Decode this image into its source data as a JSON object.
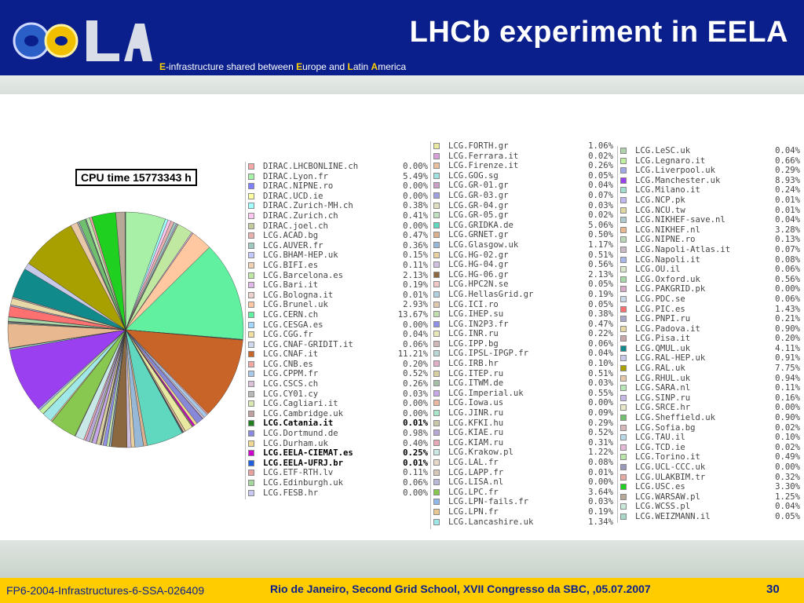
{
  "header": {
    "title": "LHCb experiment in EELA",
    "subtitle": {
      "e1": "E",
      "t1": "-infrastructure shared between ",
      "e2": "E",
      "t2": "urope and ",
      "e3": "L",
      "t3": "atin ",
      "e4": "A",
      "t4": "merica"
    },
    "logo_text": "eeLA"
  },
  "chart": {
    "label": "CPU time 15773343 h"
  },
  "chart_data": {
    "type": "pie",
    "title": "CPU time 15773343 h",
    "slices": [
      {
        "name": "DIRAC.LHCBONLINE.ch",
        "value": 0.0,
        "color": "#f7a8a8"
      },
      {
        "name": "DIRAC.Lyon.fr",
        "value": 5.49,
        "color": "#a8f0a8"
      },
      {
        "name": "DIRAC.NIPNE.ro",
        "value": 0.0,
        "color": "#8080ff"
      },
      {
        "name": "DIRAC.UCD.ie",
        "value": 0.0,
        "color": "#ffffa0"
      },
      {
        "name": "DIRAC.Zurich-MH.ch",
        "value": 0.38,
        "color": "#a0ffff"
      },
      {
        "name": "DIRAC.Zurich.ch",
        "value": 0.41,
        "color": "#ffc8f0"
      },
      {
        "name": "DIRAC.joel.ch",
        "value": 0.0,
        "color": "#c8c8a0"
      },
      {
        "name": "LCG.ACAD.bg",
        "value": 0.47,
        "color": "#e8b0b0"
      },
      {
        "name": "LCG.AUVER.fr",
        "value": 0.36,
        "color": "#a0c8c0"
      },
      {
        "name": "LCG.BHAM-HEP.uk",
        "value": 0.15,
        "color": "#c0c8ff"
      },
      {
        "name": "LCG.BIFI.es",
        "value": 0.11,
        "color": "#f0d0b0"
      },
      {
        "name": "LCG.Barcelona.es",
        "value": 2.13,
        "color": "#c0e8a0"
      },
      {
        "name": "LCG.Bari.it",
        "value": 0.19,
        "color": "#e0b8e8"
      },
      {
        "name": "LCG.Bologna.it",
        "value": 0.01,
        "color": "#e8d0d0"
      },
      {
        "name": "LCG.Brunel.uk",
        "value": 2.93,
        "color": "#ffc8a0"
      },
      {
        "name": "LCG.CERN.ch",
        "value": 13.67,
        "color": "#60f0a0"
      },
      {
        "name": "LCG.CESGA.es",
        "value": 0.0,
        "color": "#a0d8ff"
      },
      {
        "name": "LCG.CGG.fr",
        "value": 0.04,
        "color": "#f0e0a0"
      },
      {
        "name": "LCG.CNAF-GRIDIT.it",
        "value": 0.06,
        "color": "#d0d8f0"
      },
      {
        "name": "LCG.CNAF.it",
        "value": 11.21,
        "color": "#c86428"
      },
      {
        "name": "LCG.CNB.es",
        "value": 0.2,
        "color": "#f0a8a0"
      },
      {
        "name": "LCG.CPPM.fr",
        "value": 0.52,
        "color": "#a8c8e8"
      },
      {
        "name": "LCG.CSCS.ch",
        "value": 0.26,
        "color": "#d8c0d8"
      },
      {
        "name": "LCG.CY01.cy",
        "value": 0.03,
        "color": "#b8b8b8"
      },
      {
        "name": "LCG.Cagliari.it",
        "value": 0.0,
        "color": "#d8e8b0"
      },
      {
        "name": "LCG.Cambridge.uk",
        "value": 0.0,
        "color": "#c0a0a0"
      },
      {
        "name": "LCG.Catania.it",
        "value": 0.01,
        "color": "#208020",
        "bold": true
      },
      {
        "name": "LCG.Dortmund.de",
        "value": 0.98,
        "color": "#8888d8"
      },
      {
        "name": "LCG.Durham.uk",
        "value": 0.4,
        "color": "#f0d890"
      },
      {
        "name": "LCG.EELA-CIEMAT.es",
        "value": 0.25,
        "color": "#d000d0",
        "bold": true
      },
      {
        "name": "LCG.EELA-UFRJ.br",
        "value": 0.01,
        "color": "#2060e0",
        "bold": true
      },
      {
        "name": "LCG.ETF-RTH.lv",
        "value": 0.11,
        "color": "#e8a0a0"
      },
      {
        "name": "LCG.Edinburgh.uk",
        "value": 0.06,
        "color": "#a0d8a0"
      },
      {
        "name": "LCG.FESB.hr",
        "value": 0.0,
        "color": "#c8c8f0"
      },
      {
        "name": "LCG.FORTH.gr",
        "value": 1.06,
        "color": "#e8e8a0"
      },
      {
        "name": "LCG.Ferrara.it",
        "value": 0.02,
        "color": "#d8a0d8"
      },
      {
        "name": "LCG.Firenze.it",
        "value": 0.26,
        "color": "#e8c0a0"
      },
      {
        "name": "LCG.GOG.sg",
        "value": 0.05,
        "color": "#a0e0e0"
      },
      {
        "name": "LCG.GR-01.gr",
        "value": 0.04,
        "color": "#c8a0c8"
      },
      {
        "name": "LCG.GR-03.gr",
        "value": 0.07,
        "color": "#a0a0e0"
      },
      {
        "name": "LCG.GR-04.gr",
        "value": 0.03,
        "color": "#e0e0c0"
      },
      {
        "name": "LCG.GR-05.gr",
        "value": 0.02,
        "color": "#c0e0c0"
      },
      {
        "name": "LCG.GRIDKA.de",
        "value": 5.06,
        "color": "#60d8c0"
      },
      {
        "name": "LCG.GRNET.gr",
        "value": 0.5,
        "color": "#d8b090"
      },
      {
        "name": "LCG.Glasgow.uk",
        "value": 1.17,
        "color": "#98b8d8"
      },
      {
        "name": "LCG.HG-02.gr",
        "value": 0.51,
        "color": "#e8d0a0"
      },
      {
        "name": "LCG.HG-04.gr",
        "value": 0.56,
        "color": "#d0c0e0"
      },
      {
        "name": "LCG.HG-06.gr",
        "value": 2.13,
        "color": "#8c6840"
      },
      {
        "name": "LCG.HPC2N.se",
        "value": 0.05,
        "color": "#f0c8c8"
      },
      {
        "name": "LCG.HellasGrid.gr",
        "value": 0.19,
        "color": "#b0d0e0"
      },
      {
        "name": "LCG.ICI.ro",
        "value": 0.05,
        "color": "#e0c8b0"
      },
      {
        "name": "LCG.IHEP.su",
        "value": 0.38,
        "color": "#c0e0b0"
      },
      {
        "name": "LCG.IN2P3.fr",
        "value": 0.47,
        "color": "#9090e8"
      },
      {
        "name": "LCG.INR.ru",
        "value": 0.22,
        "color": "#e8e8b8"
      },
      {
        "name": "LCG.IPP.bg",
        "value": 0.06,
        "color": "#d0b8b8"
      },
      {
        "name": "LCG.IPSL-IPGP.fr",
        "value": 0.04,
        "color": "#b8d8d8"
      },
      {
        "name": "LCG.IRB.hr",
        "value": 0.1,
        "color": "#e0b0c8"
      },
      {
        "name": "LCG.ITEP.ru",
        "value": 0.51,
        "color": "#d8d0a0"
      },
      {
        "name": "LCG.ITWM.de",
        "value": 0.03,
        "color": "#a8c0a8"
      },
      {
        "name": "LCG.Imperial.uk",
        "value": 0.55,
        "color": "#c8a8e8"
      },
      {
        "name": "LCG.Iowa.us",
        "value": 0.0,
        "color": "#e8b8a0"
      },
      {
        "name": "LCG.JINR.ru",
        "value": 0.09,
        "color": "#a8e8c8"
      },
      {
        "name": "LCG.KFKI.hu",
        "value": 0.29,
        "color": "#c8c8a8"
      },
      {
        "name": "LCG.KIAE.ru",
        "value": 0.52,
        "color": "#b8a8d8"
      },
      {
        "name": "LCG.KIAM.ru",
        "value": 0.31,
        "color": "#e8a8b8"
      },
      {
        "name": "LCG.Krakow.pl",
        "value": 1.22,
        "color": "#c8e8e8"
      },
      {
        "name": "LCG.LAL.fr",
        "value": 0.08,
        "color": "#e8d8c8"
      },
      {
        "name": "LCG.LAPP.fr",
        "value": 0.01,
        "color": "#d8c8b8"
      },
      {
        "name": "LCG.LISA.nl",
        "value": 0.0,
        "color": "#b8b8d8"
      },
      {
        "name": "LCG.LPC.fr",
        "value": 3.64,
        "color": "#88c850"
      },
      {
        "name": "LCG.LPN-fails.fr",
        "value": 0.03,
        "color": "#90b8e8"
      },
      {
        "name": "LCG.LPN.fr",
        "value": 0.19,
        "color": "#e8c890"
      },
      {
        "name": "LCG.Lancashire.uk",
        "value": 1.34,
        "color": "#a0e8e8"
      },
      {
        "name": "LCG.LeSC.uk",
        "value": 0.04,
        "color": "#b0d0b0"
      },
      {
        "name": "LCG.Legnaro.it",
        "value": 0.66,
        "color": "#c0f0a0"
      },
      {
        "name": "LCG.Liverpool.uk",
        "value": 0.29,
        "color": "#a0a8e8"
      },
      {
        "name": "LCG.Manchester.uk",
        "value": 8.93,
        "color": "#9a40f0"
      },
      {
        "name": "LCG.Milano.it",
        "value": 0.24,
        "color": "#a0e0d0"
      },
      {
        "name": "LCG.NCP.pk",
        "value": 0.01,
        "color": "#c0b8f0"
      },
      {
        "name": "LCG.NCU.tw",
        "value": 0.01,
        "color": "#e0d8a0"
      },
      {
        "name": "LCG.NIKHEF-save.nl",
        "value": 0.04,
        "color": "#b0c8d0"
      },
      {
        "name": "LCG.NIKHEF.nl",
        "value": 3.28,
        "color": "#e8b890"
      },
      {
        "name": "LCG.NIPNE.ro",
        "value": 0.13,
        "color": "#b8d8b8"
      },
      {
        "name": "LCG.Napoli-Atlas.it",
        "value": 0.07,
        "color": "#c8b8c8"
      },
      {
        "name": "LCG.Napoli.it",
        "value": 0.08,
        "color": "#a8b8e8"
      },
      {
        "name": "LCG.OU.il",
        "value": 0.06,
        "color": "#d8e8c8"
      },
      {
        "name": "LCG.Oxford.uk",
        "value": 0.56,
        "color": "#a8d8a8"
      },
      {
        "name": "LCG.PAKGRID.pk",
        "value": 0.0,
        "color": "#d8a8c8"
      },
      {
        "name": "LCG.PDC.se",
        "value": 0.06,
        "color": "#c8d8e8"
      },
      {
        "name": "LCG.PIC.es",
        "value": 1.43,
        "color": "#ff7070"
      },
      {
        "name": "LCG.PNPI.ru",
        "value": 0.21,
        "color": "#a8a8c8"
      },
      {
        "name": "LCG.Padova.it",
        "value": 0.9,
        "color": "#e8d8a8"
      },
      {
        "name": "LCG.Pisa.it",
        "value": 0.2,
        "color": "#c8a8a8"
      },
      {
        "name": "LCG.QMUL.uk",
        "value": 4.11,
        "color": "#108a8a"
      },
      {
        "name": "LCG.RAL-HEP.uk",
        "value": 0.91,
        "color": "#c8c8e8"
      },
      {
        "name": "LCG.RAL.uk",
        "value": 7.75,
        "color": "#a8a000"
      },
      {
        "name": "LCG.RHUL.uk",
        "value": 0.94,
        "color": "#e8c8a8"
      },
      {
        "name": "LCG.SARA.nl",
        "value": 0.11,
        "color": "#b8e8b8"
      },
      {
        "name": "LCG.SINP.ru",
        "value": 0.16,
        "color": "#c8b8e8"
      },
      {
        "name": "LCG.SRCE.hr",
        "value": 0.0,
        "color": "#e8e8c8"
      },
      {
        "name": "LCG.Sheffield.uk",
        "value": 0.9,
        "color": "#70c070"
      },
      {
        "name": "LCG.Sofia.bg",
        "value": 0.02,
        "color": "#d8b8b8"
      },
      {
        "name": "LCG.TAU.il",
        "value": 0.1,
        "color": "#b8d8e8"
      },
      {
        "name": "LCG.TCD.ie",
        "value": 0.02,
        "color": "#e8b8d8"
      },
      {
        "name": "LCG.Torino.it",
        "value": 0.49,
        "color": "#b8e8a8"
      },
      {
        "name": "LCG.UCL-CCC.uk",
        "value": 0.0,
        "color": "#9898b8"
      },
      {
        "name": "LCG.ULAKBIM.tr",
        "value": 0.32,
        "color": "#e8a8a8"
      },
      {
        "name": "LCG.USC.es",
        "value": 3.3,
        "color": "#20d020"
      },
      {
        "name": "LCG.WARSAW.pl",
        "value": 1.25,
        "color": "#b8a898"
      },
      {
        "name": "LCG.WCSS.pl",
        "value": 0.04,
        "color": "#c8e8d8"
      },
      {
        "name": "LCG.WEIZMANN.il",
        "value": 0.05,
        "color": "#a8d8c8"
      }
    ]
  },
  "legend_columns": [
    {
      "start": 0,
      "end": 34
    },
    {
      "start": 34,
      "end": 73
    },
    {
      "start": 73,
      "end": 111
    }
  ],
  "footer": {
    "left": "FP6-2004-Infrastructures-6-SSA-026409",
    "center": "Rio de Janeiro, Second Grid School, XVII Congresso da SBC, ,05.07.2007",
    "page": "30"
  }
}
